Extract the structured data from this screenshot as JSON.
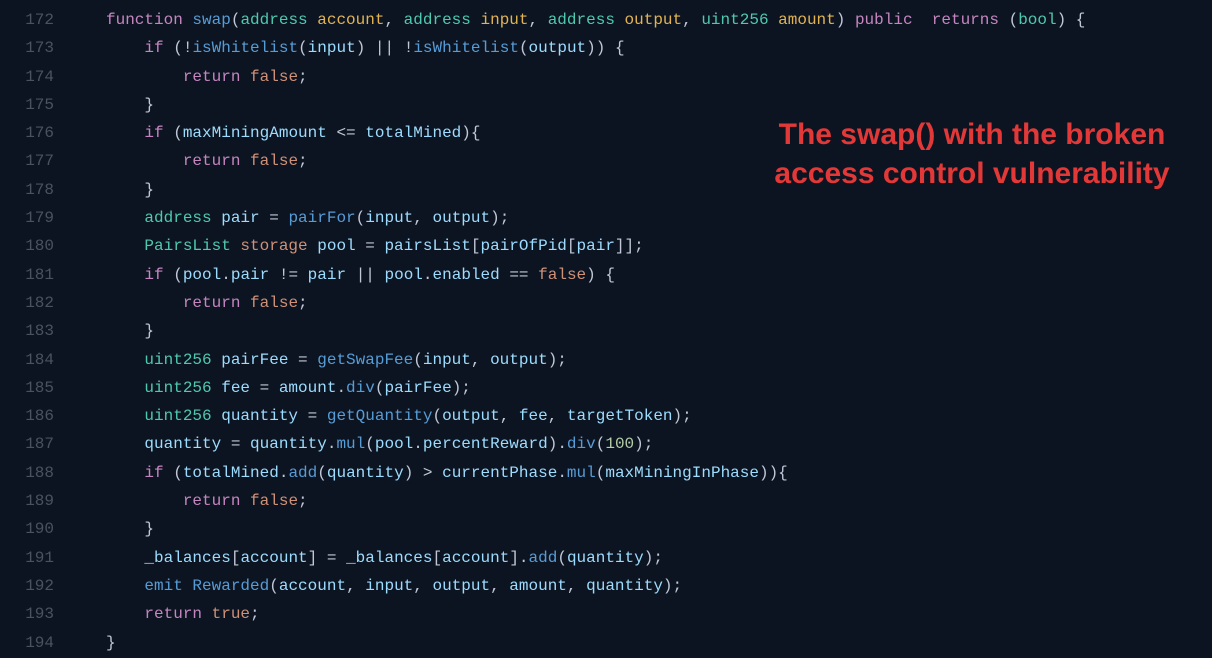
{
  "annotation": "The swap() with the broken access control vulnerability",
  "lines": [
    {
      "num": "172",
      "tokens": [
        {
          "t": "function ",
          "c": "kw"
        },
        {
          "t": "swap",
          "c": "fn"
        },
        {
          "t": "(",
          "c": "punct"
        },
        {
          "t": "address ",
          "c": "type"
        },
        {
          "t": "account",
          "c": "param"
        },
        {
          "t": ", ",
          "c": "punct"
        },
        {
          "t": "address ",
          "c": "type"
        },
        {
          "t": "input",
          "c": "param"
        },
        {
          "t": ", ",
          "c": "punct"
        },
        {
          "t": "address ",
          "c": "type"
        },
        {
          "t": "output",
          "c": "param"
        },
        {
          "t": ", ",
          "c": "punct"
        },
        {
          "t": "uint256 ",
          "c": "type"
        },
        {
          "t": "amount",
          "c": "param"
        },
        {
          "t": ") ",
          "c": "punct"
        },
        {
          "t": "public  ",
          "c": "kw"
        },
        {
          "t": "returns ",
          "c": "kw"
        },
        {
          "t": "(",
          "c": "punct"
        },
        {
          "t": "bool",
          "c": "type"
        },
        {
          "t": ") {",
          "c": "punct"
        }
      ]
    },
    {
      "num": "173",
      "tokens": [
        {
          "t": "    ",
          "c": ""
        },
        {
          "t": "if ",
          "c": "kw"
        },
        {
          "t": "(",
          "c": "punct"
        },
        {
          "t": "!",
          "c": "op"
        },
        {
          "t": "isWhitelist",
          "c": "fn"
        },
        {
          "t": "(",
          "c": "punct"
        },
        {
          "t": "input",
          "c": "local"
        },
        {
          "t": ") ",
          "c": "punct"
        },
        {
          "t": "|| ",
          "c": "op"
        },
        {
          "t": "!",
          "c": "op"
        },
        {
          "t": "isWhitelist",
          "c": "fn"
        },
        {
          "t": "(",
          "c": "punct"
        },
        {
          "t": "output",
          "c": "local"
        },
        {
          "t": ")) {",
          "c": "punct"
        }
      ]
    },
    {
      "num": "174",
      "tokens": [
        {
          "t": "        ",
          "c": ""
        },
        {
          "t": "return ",
          "c": "kw"
        },
        {
          "t": "false",
          "c": "const"
        },
        {
          "t": ";",
          "c": "punct"
        }
      ]
    },
    {
      "num": "175",
      "tokens": [
        {
          "t": "    }",
          "c": "punct"
        }
      ]
    },
    {
      "num": "176",
      "tokens": [
        {
          "t": "    ",
          "c": ""
        },
        {
          "t": "if ",
          "c": "kw"
        },
        {
          "t": "(",
          "c": "punct"
        },
        {
          "t": "maxMiningAmount ",
          "c": "local"
        },
        {
          "t": "<= ",
          "c": "op"
        },
        {
          "t": "totalMined",
          "c": "local"
        },
        {
          "t": "){",
          "c": "punct"
        }
      ]
    },
    {
      "num": "177",
      "tokens": [
        {
          "t": "        ",
          "c": ""
        },
        {
          "t": "return ",
          "c": "kw"
        },
        {
          "t": "false",
          "c": "const"
        },
        {
          "t": ";",
          "c": "punct"
        }
      ]
    },
    {
      "num": "178",
      "tokens": [
        {
          "t": "    }",
          "c": "punct"
        }
      ]
    },
    {
      "num": "179",
      "tokens": [
        {
          "t": "    ",
          "c": ""
        },
        {
          "t": "address ",
          "c": "type"
        },
        {
          "t": "pair ",
          "c": "local"
        },
        {
          "t": "= ",
          "c": "op"
        },
        {
          "t": "pairFor",
          "c": "fn"
        },
        {
          "t": "(",
          "c": "punct"
        },
        {
          "t": "input",
          "c": "local"
        },
        {
          "t": ", ",
          "c": "punct"
        },
        {
          "t": "output",
          "c": "local"
        },
        {
          "t": ");",
          "c": "punct"
        }
      ]
    },
    {
      "num": "180",
      "tokens": [
        {
          "t": "    ",
          "c": ""
        },
        {
          "t": "PairsList ",
          "c": "type"
        },
        {
          "t": "storage ",
          "c": "stor"
        },
        {
          "t": "pool ",
          "c": "local"
        },
        {
          "t": "= ",
          "c": "op"
        },
        {
          "t": "pairsList",
          "c": "local"
        },
        {
          "t": "[",
          "c": "punct"
        },
        {
          "t": "pairOfPid",
          "c": "local"
        },
        {
          "t": "[",
          "c": "punct"
        },
        {
          "t": "pair",
          "c": "local"
        },
        {
          "t": "]];",
          "c": "punct"
        }
      ]
    },
    {
      "num": "181",
      "tokens": [
        {
          "t": "    ",
          "c": ""
        },
        {
          "t": "if ",
          "c": "kw"
        },
        {
          "t": "(",
          "c": "punct"
        },
        {
          "t": "pool",
          "c": "local"
        },
        {
          "t": ".",
          "c": "punct"
        },
        {
          "t": "pair ",
          "c": "local"
        },
        {
          "t": "!= ",
          "c": "op"
        },
        {
          "t": "pair ",
          "c": "local"
        },
        {
          "t": "|| ",
          "c": "op"
        },
        {
          "t": "pool",
          "c": "local"
        },
        {
          "t": ".",
          "c": "punct"
        },
        {
          "t": "enabled ",
          "c": "local"
        },
        {
          "t": "== ",
          "c": "op"
        },
        {
          "t": "false",
          "c": "const"
        },
        {
          "t": ") {",
          "c": "punct"
        }
      ]
    },
    {
      "num": "182",
      "tokens": [
        {
          "t": "        ",
          "c": ""
        },
        {
          "t": "return ",
          "c": "kw"
        },
        {
          "t": "false",
          "c": "const"
        },
        {
          "t": ";",
          "c": "punct"
        }
      ]
    },
    {
      "num": "183",
      "tokens": [
        {
          "t": "    }",
          "c": "punct"
        }
      ]
    },
    {
      "num": "184",
      "tokens": [
        {
          "t": "    ",
          "c": ""
        },
        {
          "t": "uint256 ",
          "c": "type"
        },
        {
          "t": "pairFee ",
          "c": "local"
        },
        {
          "t": "= ",
          "c": "op"
        },
        {
          "t": "getSwapFee",
          "c": "fn"
        },
        {
          "t": "(",
          "c": "punct"
        },
        {
          "t": "input",
          "c": "local"
        },
        {
          "t": ", ",
          "c": "punct"
        },
        {
          "t": "output",
          "c": "local"
        },
        {
          "t": ");",
          "c": "punct"
        }
      ]
    },
    {
      "num": "185",
      "tokens": [
        {
          "t": "    ",
          "c": ""
        },
        {
          "t": "uint256 ",
          "c": "type"
        },
        {
          "t": "fee ",
          "c": "local"
        },
        {
          "t": "= ",
          "c": "op"
        },
        {
          "t": "amount",
          "c": "local"
        },
        {
          "t": ".",
          "c": "punct"
        },
        {
          "t": "div",
          "c": "fn"
        },
        {
          "t": "(",
          "c": "punct"
        },
        {
          "t": "pairFee",
          "c": "local"
        },
        {
          "t": ");",
          "c": "punct"
        }
      ]
    },
    {
      "num": "186",
      "tokens": [
        {
          "t": "    ",
          "c": ""
        },
        {
          "t": "uint256 ",
          "c": "type"
        },
        {
          "t": "quantity ",
          "c": "local"
        },
        {
          "t": "= ",
          "c": "op"
        },
        {
          "t": "getQuantity",
          "c": "fn"
        },
        {
          "t": "(",
          "c": "punct"
        },
        {
          "t": "output",
          "c": "local"
        },
        {
          "t": ", ",
          "c": "punct"
        },
        {
          "t": "fee",
          "c": "local"
        },
        {
          "t": ", ",
          "c": "punct"
        },
        {
          "t": "targetToken",
          "c": "local"
        },
        {
          "t": ");",
          "c": "punct"
        }
      ]
    },
    {
      "num": "187",
      "tokens": [
        {
          "t": "    ",
          "c": ""
        },
        {
          "t": "quantity ",
          "c": "local"
        },
        {
          "t": "= ",
          "c": "op"
        },
        {
          "t": "quantity",
          "c": "local"
        },
        {
          "t": ".",
          "c": "punct"
        },
        {
          "t": "mul",
          "c": "fn"
        },
        {
          "t": "(",
          "c": "punct"
        },
        {
          "t": "pool",
          "c": "local"
        },
        {
          "t": ".",
          "c": "punct"
        },
        {
          "t": "percentReward",
          "c": "local"
        },
        {
          "t": ").",
          "c": "punct"
        },
        {
          "t": "div",
          "c": "fn"
        },
        {
          "t": "(",
          "c": "punct"
        },
        {
          "t": "100",
          "c": "num"
        },
        {
          "t": ");",
          "c": "punct"
        }
      ]
    },
    {
      "num": "188",
      "tokens": [
        {
          "t": "    ",
          "c": ""
        },
        {
          "t": "if ",
          "c": "kw"
        },
        {
          "t": "(",
          "c": "punct"
        },
        {
          "t": "totalMined",
          "c": "local"
        },
        {
          "t": ".",
          "c": "punct"
        },
        {
          "t": "add",
          "c": "fn"
        },
        {
          "t": "(",
          "c": "punct"
        },
        {
          "t": "quantity",
          "c": "local"
        },
        {
          "t": ") ",
          "c": "punct"
        },
        {
          "t": "> ",
          "c": "op"
        },
        {
          "t": "currentPhase",
          "c": "local"
        },
        {
          "t": ".",
          "c": "punct"
        },
        {
          "t": "mul",
          "c": "fn"
        },
        {
          "t": "(",
          "c": "punct"
        },
        {
          "t": "maxMiningInPhase",
          "c": "local"
        },
        {
          "t": ")){",
          "c": "punct"
        }
      ]
    },
    {
      "num": "189",
      "tokens": [
        {
          "t": "        ",
          "c": ""
        },
        {
          "t": "return ",
          "c": "kw"
        },
        {
          "t": "false",
          "c": "const"
        },
        {
          "t": ";",
          "c": "punct"
        }
      ]
    },
    {
      "num": "190",
      "tokens": [
        {
          "t": "    }",
          "c": "punct"
        }
      ]
    },
    {
      "num": "191",
      "tokens": [
        {
          "t": "    ",
          "c": ""
        },
        {
          "t": "_balances",
          "c": "local"
        },
        {
          "t": "[",
          "c": "punct"
        },
        {
          "t": "account",
          "c": "local"
        },
        {
          "t": "] ",
          "c": "punct"
        },
        {
          "t": "= ",
          "c": "op"
        },
        {
          "t": "_balances",
          "c": "local"
        },
        {
          "t": "[",
          "c": "punct"
        },
        {
          "t": "account",
          "c": "local"
        },
        {
          "t": "].",
          "c": "punct"
        },
        {
          "t": "add",
          "c": "fn"
        },
        {
          "t": "(",
          "c": "punct"
        },
        {
          "t": "quantity",
          "c": "local"
        },
        {
          "t": ");",
          "c": "punct"
        }
      ]
    },
    {
      "num": "192",
      "tokens": [
        {
          "t": "    ",
          "c": ""
        },
        {
          "t": "emit ",
          "c": "emit"
        },
        {
          "t": "Rewarded",
          "c": "fn"
        },
        {
          "t": "(",
          "c": "punct"
        },
        {
          "t": "account",
          "c": "local"
        },
        {
          "t": ", ",
          "c": "punct"
        },
        {
          "t": "input",
          "c": "local"
        },
        {
          "t": ", ",
          "c": "punct"
        },
        {
          "t": "output",
          "c": "local"
        },
        {
          "t": ", ",
          "c": "punct"
        },
        {
          "t": "amount",
          "c": "local"
        },
        {
          "t": ", ",
          "c": "punct"
        },
        {
          "t": "quantity",
          "c": "local"
        },
        {
          "t": ");",
          "c": "punct"
        }
      ]
    },
    {
      "num": "193",
      "tokens": [
        {
          "t": "    ",
          "c": ""
        },
        {
          "t": "return ",
          "c": "kw"
        },
        {
          "t": "true",
          "c": "const"
        },
        {
          "t": ";",
          "c": "punct"
        }
      ]
    },
    {
      "num": "194",
      "tokens": [
        {
          "t": "}",
          "c": "punct"
        }
      ]
    }
  ]
}
